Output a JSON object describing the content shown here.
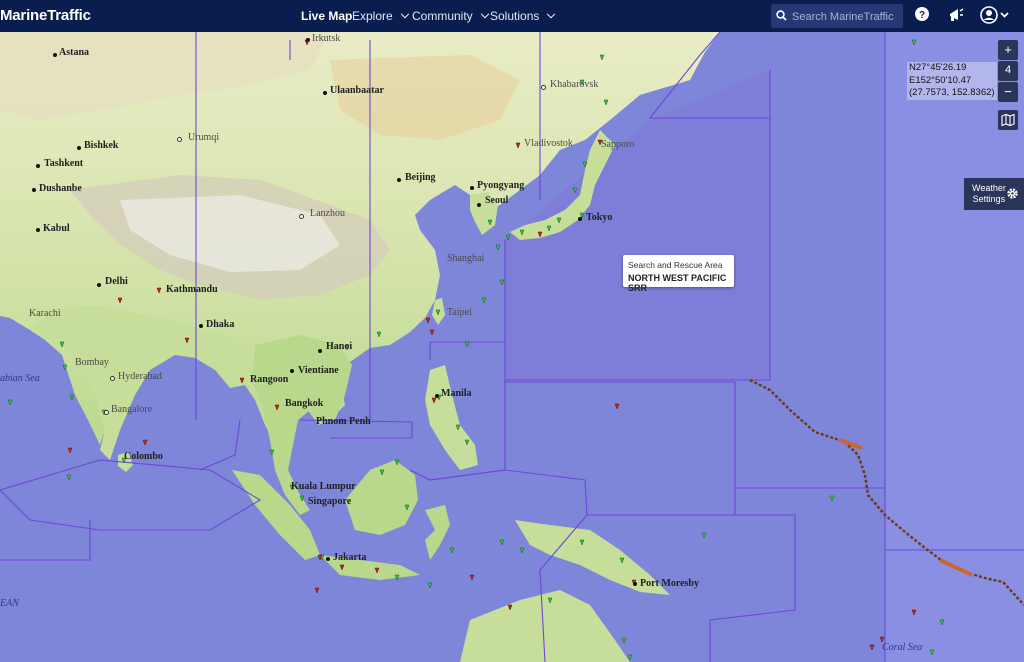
{
  "header": {
    "logo": "MarineTraffic",
    "nav": [
      {
        "label": "Live Map"
      },
      {
        "label": "Explore"
      },
      {
        "label": "Community"
      },
      {
        "label": "Solutions"
      }
    ],
    "search_placeholder": "Search MarineTraffic"
  },
  "map": {
    "zoom_in": "+",
    "zoom_level": "4",
    "zoom_out": "−",
    "coordinates": {
      "lat": "N27°45'26.19",
      "lon": "E152°50'10.47",
      "decimal": "(27.7573, 152.8362)"
    },
    "weather_settings": "Weather\nSettings",
    "tooltip": {
      "title": "Search and Rescue Area",
      "name": "NORTH WEST PACIFIC SRR"
    },
    "cities": {
      "irkutsk": "Irkutsk",
      "astana": "Astana",
      "khabarovsk": "Khabarovsk",
      "ulaanbaatar": "Ulaanbaatar",
      "bishkek": "Bishkek",
      "urumqi": "Urumqi",
      "vladivostok": "Vladivostok",
      "sapporo": "Sapporo",
      "tashkent": "Tashkent",
      "beijing": "Beijing",
      "pyongyang": "Pyongyang",
      "dushanbe": "Dushanbe",
      "seoul": "Seoul",
      "lanzhou": "Lanzhou",
      "tokyo": "Tokyo",
      "kabul": "Kabul",
      "shanghai": "Shanghai",
      "delhi": "Delhi",
      "kathmandu": "Kathmandu",
      "taipei": "Taipei",
      "karachi": "Karachi",
      "dhaka": "Dhaka",
      "hanoi": "Hanoi",
      "bombay": "Bombay",
      "vientiane": "Vientiane",
      "arabian_sea": "abian Sea",
      "hyderabad": "Hyderabad",
      "rangoon": "Rangoon",
      "manila": "Manila",
      "bangalore": "Bangalore",
      "bangkok": "Bangkok",
      "phnom_penh": "Phnom Penh",
      "colombo": "Colombo",
      "kuala_lumpur": "Kuala Lumpur",
      "singapore": "Singapore",
      "jakarta": "Jakarta",
      "port_moresby": "Port Moresby",
      "ean": "EAN",
      "coral_sea": "Coral Sea"
    }
  },
  "colors": {
    "header_bg": "#0a1d4f",
    "sea": "#7d86d9",
    "srr_zone": "#8c84e6",
    "vessel_green": "#38c43a",
    "vessel_red": "#c2271c",
    "storm_track": "#6b3a10"
  }
}
